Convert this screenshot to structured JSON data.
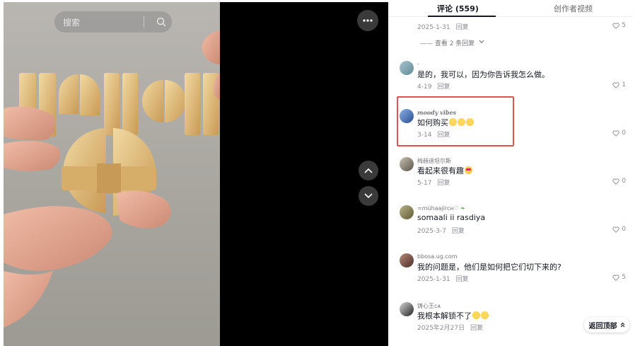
{
  "video": {
    "search_placeholder": "搜索"
  },
  "tabs": {
    "comments_label": "评论 (559)",
    "creator_videos_label": "创作者视频"
  },
  "comments": [
    {
      "name": "",
      "text": "",
      "date": "2025-1-31",
      "reply": "回复",
      "likes": "5"
    },
    {
      "name": "-",
      "text": "是的，我可以，因为你告诉我怎么做。",
      "date": "4-19",
      "reply": "回复",
      "likes": "1"
    },
    {
      "name": "moody vibes",
      "text": "如何购买",
      "date": "3-14",
      "reply": "回复",
      "likes": "0"
    },
    {
      "name": "梅赫迪坦尔斯",
      "text": "看起来很有趣",
      "date": "5-17",
      "reply": "回复",
      "likes": "0"
    },
    {
      "name": "≍mŭhaajĭrcн♡",
      "text": "somaali ii rasdiya",
      "date": "2025-3-7",
      "reply": "回复",
      "likes": "0"
    },
    {
      "name": "bbosa.ug.com",
      "text": "我的问题是，他们是如何把它们切下来的?",
      "date": "2025-1-31",
      "reply": "回复",
      "likes": "5"
    },
    {
      "name": "铸心王ᴄᴀ",
      "text": "我根本解锁不了",
      "date": "2025年2月27日",
      "reply": "回复",
      "likes": ""
    }
  ],
  "view_replies": "—— 查看 2 条回复",
  "back_to_top": "返回顶部",
  "colors": {
    "highlight": "#e35050",
    "text": "#161823",
    "meta": "#8a8b91"
  }
}
